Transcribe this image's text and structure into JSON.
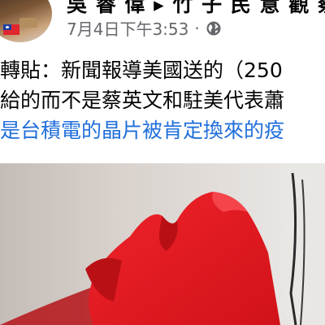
{
  "post": {
    "author": "吳 睿 偉 ▸ 竹 子 民 意 觀 察 站",
    "date": "7月4日下午3:53",
    "separator": "·",
    "privacy_icon": "globe-icon",
    "lines": [
      "轉貼：新聞報導美國送的（250",
      "給的而不是蔡英文和駐美代表蕭",
      "是台積電的晶片被肯定換來的疫"
    ]
  },
  "colors": {
    "hashtag": "#216fdb",
    "meta": "#65676b",
    "text": "#050505",
    "image_accent": "#e0141a"
  }
}
